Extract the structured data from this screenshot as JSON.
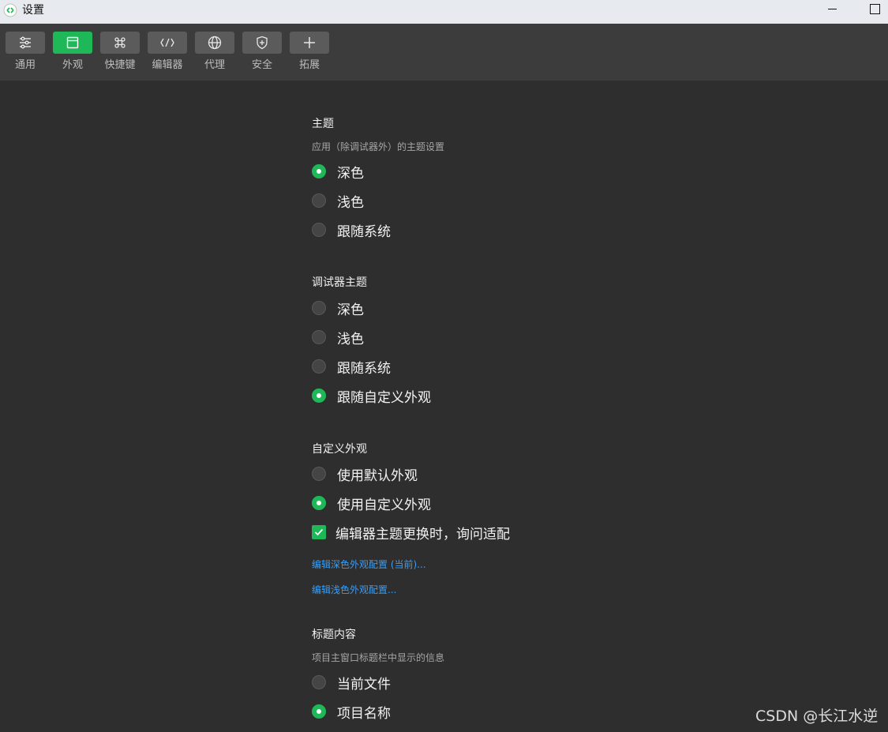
{
  "window": {
    "title": "设置"
  },
  "toolbar": {
    "tabs": [
      {
        "label": "通用",
        "icon": "sliders-icon",
        "active": false
      },
      {
        "label": "外观",
        "icon": "window-icon",
        "active": true
      },
      {
        "label": "快捷键",
        "icon": "command-key-icon",
        "active": false
      },
      {
        "label": "编辑器",
        "icon": "code-icon",
        "active": false
      },
      {
        "label": "代理",
        "icon": "globe-icon",
        "active": false
      },
      {
        "label": "安全",
        "icon": "shield-icon",
        "active": false
      },
      {
        "label": "拓展",
        "icon": "plus-icon",
        "active": false
      }
    ]
  },
  "theme": {
    "title": "主题",
    "description": "应用（除调试器外）的主题设置",
    "options": [
      {
        "label": "深色",
        "selected": true
      },
      {
        "label": "浅色",
        "selected": false
      },
      {
        "label": "跟随系统",
        "selected": false
      }
    ]
  },
  "debugger_theme": {
    "title": "调试器主题",
    "options": [
      {
        "label": "深色",
        "selected": false
      },
      {
        "label": "浅色",
        "selected": false
      },
      {
        "label": "跟随系统",
        "selected": false
      },
      {
        "label": "跟随自定义外观",
        "selected": true
      }
    ]
  },
  "custom_appearance": {
    "title": "自定义外观",
    "options": [
      {
        "label": "使用默认外观",
        "selected": false
      },
      {
        "label": "使用自定义外观",
        "selected": true
      }
    ],
    "checkbox": {
      "label": "编辑器主题更换时，询问适配",
      "checked": true
    },
    "links": [
      "编辑深色外观配置 (当前)...",
      "编辑浅色外观配置..."
    ]
  },
  "title_content": {
    "title": "标题内容",
    "description": "项目主窗口标题栏中显示的信息",
    "options": [
      {
        "label": "当前文件",
        "selected": false
      },
      {
        "label": "项目名称",
        "selected": true
      }
    ]
  },
  "watermark": "CSDN @长江水逆",
  "colors": {
    "accent": "#1eb858",
    "link": "#3d9cf0",
    "background": "#2e2e2e",
    "toolbar": "#3c3c3c"
  }
}
